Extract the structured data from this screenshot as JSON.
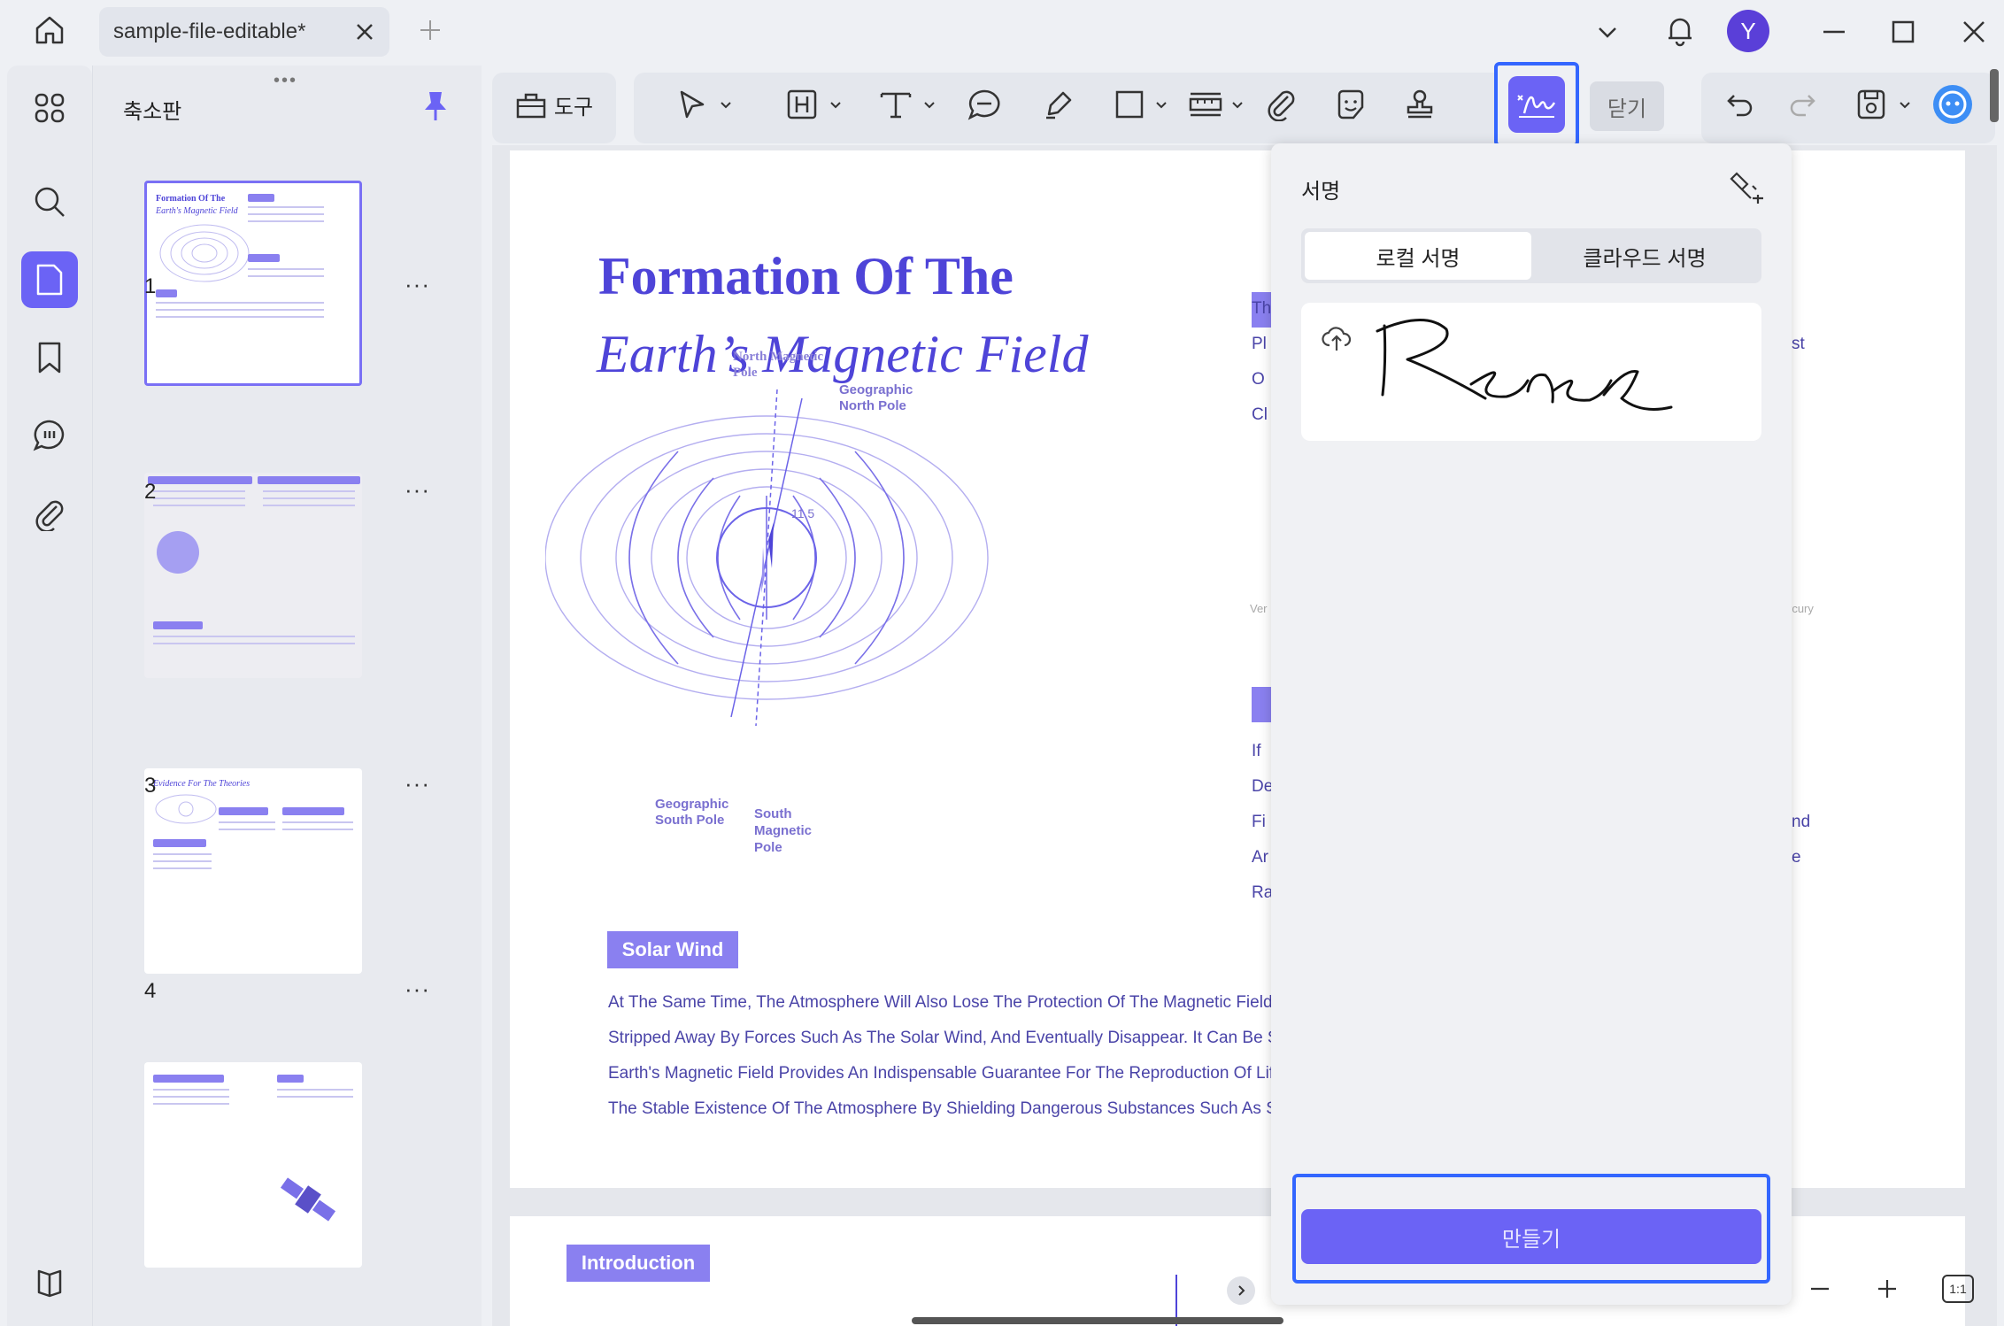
{
  "tab": {
    "title": "sample-file-editable*"
  },
  "user": {
    "avatar_letter": "Y"
  },
  "thumbnails": {
    "title": "축소판",
    "pages": [
      {
        "number": "1",
        "more": "···",
        "heading1": "Formation Of The",
        "heading2": "Earth's Magnetic Field"
      },
      {
        "number": "2",
        "more": "···"
      },
      {
        "number": "3",
        "more": "···",
        "heading1": "Evidence For The Theories"
      },
      {
        "number": "4",
        "more": "···"
      }
    ]
  },
  "toolbar": {
    "tools_label": "도구",
    "close_label": "닫기"
  },
  "document": {
    "title_line1": "Formation Of The",
    "title_line2": "Earth’s Magnetic Field",
    "diagram_labels": {
      "north_magnetic": "North Magnetic Pole",
      "geographic_north": "Geographic North Pole",
      "geographic_south": "Geographic South Pole",
      "south_magnetic": "South Magnetic Pole",
      "angle": "11.5"
    },
    "solar_wind_tag": "Solar Wind",
    "body_lines": [
      "At The Same Time, The Atmosphere Will Also Lose The Protection Of The Magnetic Field",
      "Stripped Away By Forces Such As The Solar Wind, And Eventually Disappear. It Can Be S",
      "Earth's Magnetic Field Provides An Indispensable Guarantee For The Reproduction Of Life",
      "The Stable Existence Of The Atmosphere By Shielding Dangerous Substances Such As So"
    ],
    "right_fragments_a": [
      "Th",
      "Pl",
      "O",
      "Cl"
    ],
    "right_fragments_b": [
      "If",
      "De",
      "Fi",
      "Ar",
      "Ra"
    ],
    "right_edge_a": "st",
    "right_edge_b": [
      "nd",
      "e"
    ],
    "right_small_left": "Ver",
    "right_small_right": "rcury",
    "page2_tag": "Introduction"
  },
  "signature_panel": {
    "title": "서명",
    "tab_local": "로컬 서명",
    "tab_cloud": "클라우드 서명",
    "create_label": "만들기"
  },
  "zoom": {
    "fit_label": "1:1"
  },
  "colors": {
    "accent": "#6b63f5",
    "focus": "#3366ff",
    "doc_purple": "#4e44d8"
  }
}
